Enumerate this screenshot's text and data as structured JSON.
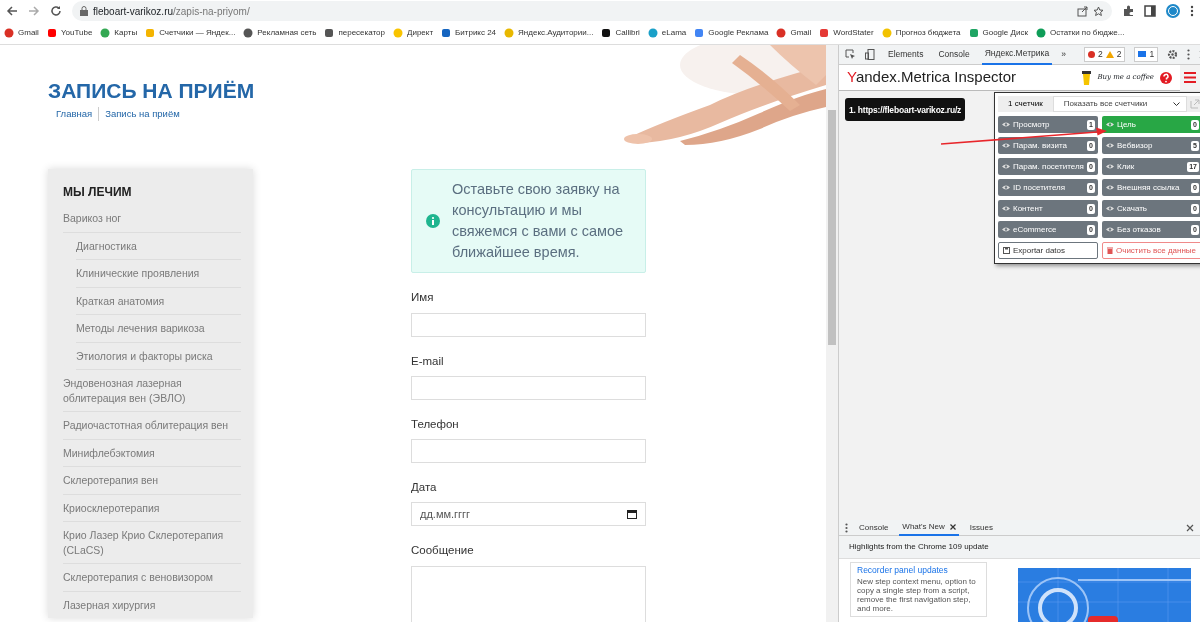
{
  "browser": {
    "url_host": "fleboart-varikoz.ru",
    "url_path": "/zapis-na-priyom/",
    "bookmarks": [
      "Gmail",
      "YouTube",
      "Карты",
      "Счетчики — Яндек...",
      "Рекламная сеть",
      "пересекатор",
      "Директ",
      "Битрикс 24",
      "Яндекс.Аудитории...",
      "Callibri",
      "eLama",
      "Google Реклама",
      "Gmail",
      "WordStater",
      "Прогноз бюджета",
      "Google Диск",
      "Остатки по бюдже..."
    ]
  },
  "page": {
    "title": "ЗАПИСЬ НА ПРИЁМ",
    "breadcrumbs": [
      "Главная",
      "Запись на приём"
    ],
    "sidebar": {
      "heading": "МЫ ЛЕЧИМ",
      "items": [
        {
          "label": "Варикоз ног",
          "children": [
            {
              "label": "Диагностика"
            },
            {
              "label": "Клинические проявления"
            },
            {
              "label": "Краткая анатомия"
            },
            {
              "label": "Методы лечения варикоза"
            },
            {
              "label": "Этиология и факторы риска"
            }
          ]
        },
        {
          "label": "Эндовенозная лазерная облитерация вен (ЭВЛО)"
        },
        {
          "label": "Радиочастотная облитерация вен"
        },
        {
          "label": "Минифлебэктомия"
        },
        {
          "label": "Склеротерапия вен"
        },
        {
          "label": "Криосклеротерапия"
        },
        {
          "label": "Крио Лазер Крио Склеротерапия (CLaCS)"
        },
        {
          "label": "Склеротерапия с веновизором"
        },
        {
          "label": "Лазерная хирургия"
        }
      ]
    },
    "notice": "Оставьте свою заявку на консультацию и мы свяжемся с вами с самое ближайшее время.",
    "form": [
      {
        "kind": "text",
        "label": "Имя"
      },
      {
        "kind": "text",
        "label": "E-mail"
      },
      {
        "kind": "text",
        "label": "Телефон"
      },
      {
        "kind": "date",
        "label": "Дата",
        "placeholder": "дд.мм.гггг"
      },
      {
        "kind": "textarea",
        "label": "Сообщение"
      }
    ]
  },
  "devtools": {
    "tabs": [
      {
        "label": "Elements",
        "selected": false
      },
      {
        "label": "Console",
        "selected": false
      },
      {
        "label": "Яндекс.Метрика",
        "selected": true
      }
    ],
    "more": "»",
    "errors": "2",
    "warnings": "2",
    "messages": "1",
    "metrica": {
      "title": "Yandex.Metrica Inspector",
      "coffee": "Buy me a coffee",
      "url_item": "1. https://fleboart-varikoz.ru/z",
      "counter_tab": "1 счетчик",
      "select": "Показать все счетчики",
      "events": [
        {
          "label": "Просмотр",
          "count": "1",
          "active": false
        },
        {
          "label": "Цель",
          "count": "0",
          "active": true
        },
        {
          "label": "Парам. визита",
          "count": "0",
          "active": false
        },
        {
          "label": "Вебвизор",
          "count": "5",
          "active": false
        },
        {
          "label": "Парам. посетителя",
          "count": "0",
          "active": false
        },
        {
          "label": "Клик",
          "count": "17",
          "active": false
        },
        {
          "label": "ID посетителя",
          "count": "0",
          "active": false
        },
        {
          "label": "Внешняя ссылка",
          "count": "0",
          "active": false
        },
        {
          "label": "Контент",
          "count": "0",
          "active": false
        },
        {
          "label": "Скачать",
          "count": "0",
          "active": false
        },
        {
          "label": "eCommerce",
          "count": "0",
          "active": false
        },
        {
          "label": "Без отказов",
          "count": "0",
          "active": false
        }
      ],
      "export": "Exportar datos",
      "clear": "Очистить все данные"
    },
    "drawer": {
      "tabs": [
        {
          "label": "Console",
          "selected": false,
          "closable": false
        },
        {
          "label": "What's New",
          "selected": true,
          "closable": true
        },
        {
          "label": "Issues",
          "selected": false,
          "closable": false
        }
      ],
      "heading": "Highlights from the Chrome 109 update",
      "card": {
        "title": "Recorder panel updates",
        "text": "New step context menu, option to copy a single step from a script, remove the first navigation step, and more."
      }
    }
  }
}
